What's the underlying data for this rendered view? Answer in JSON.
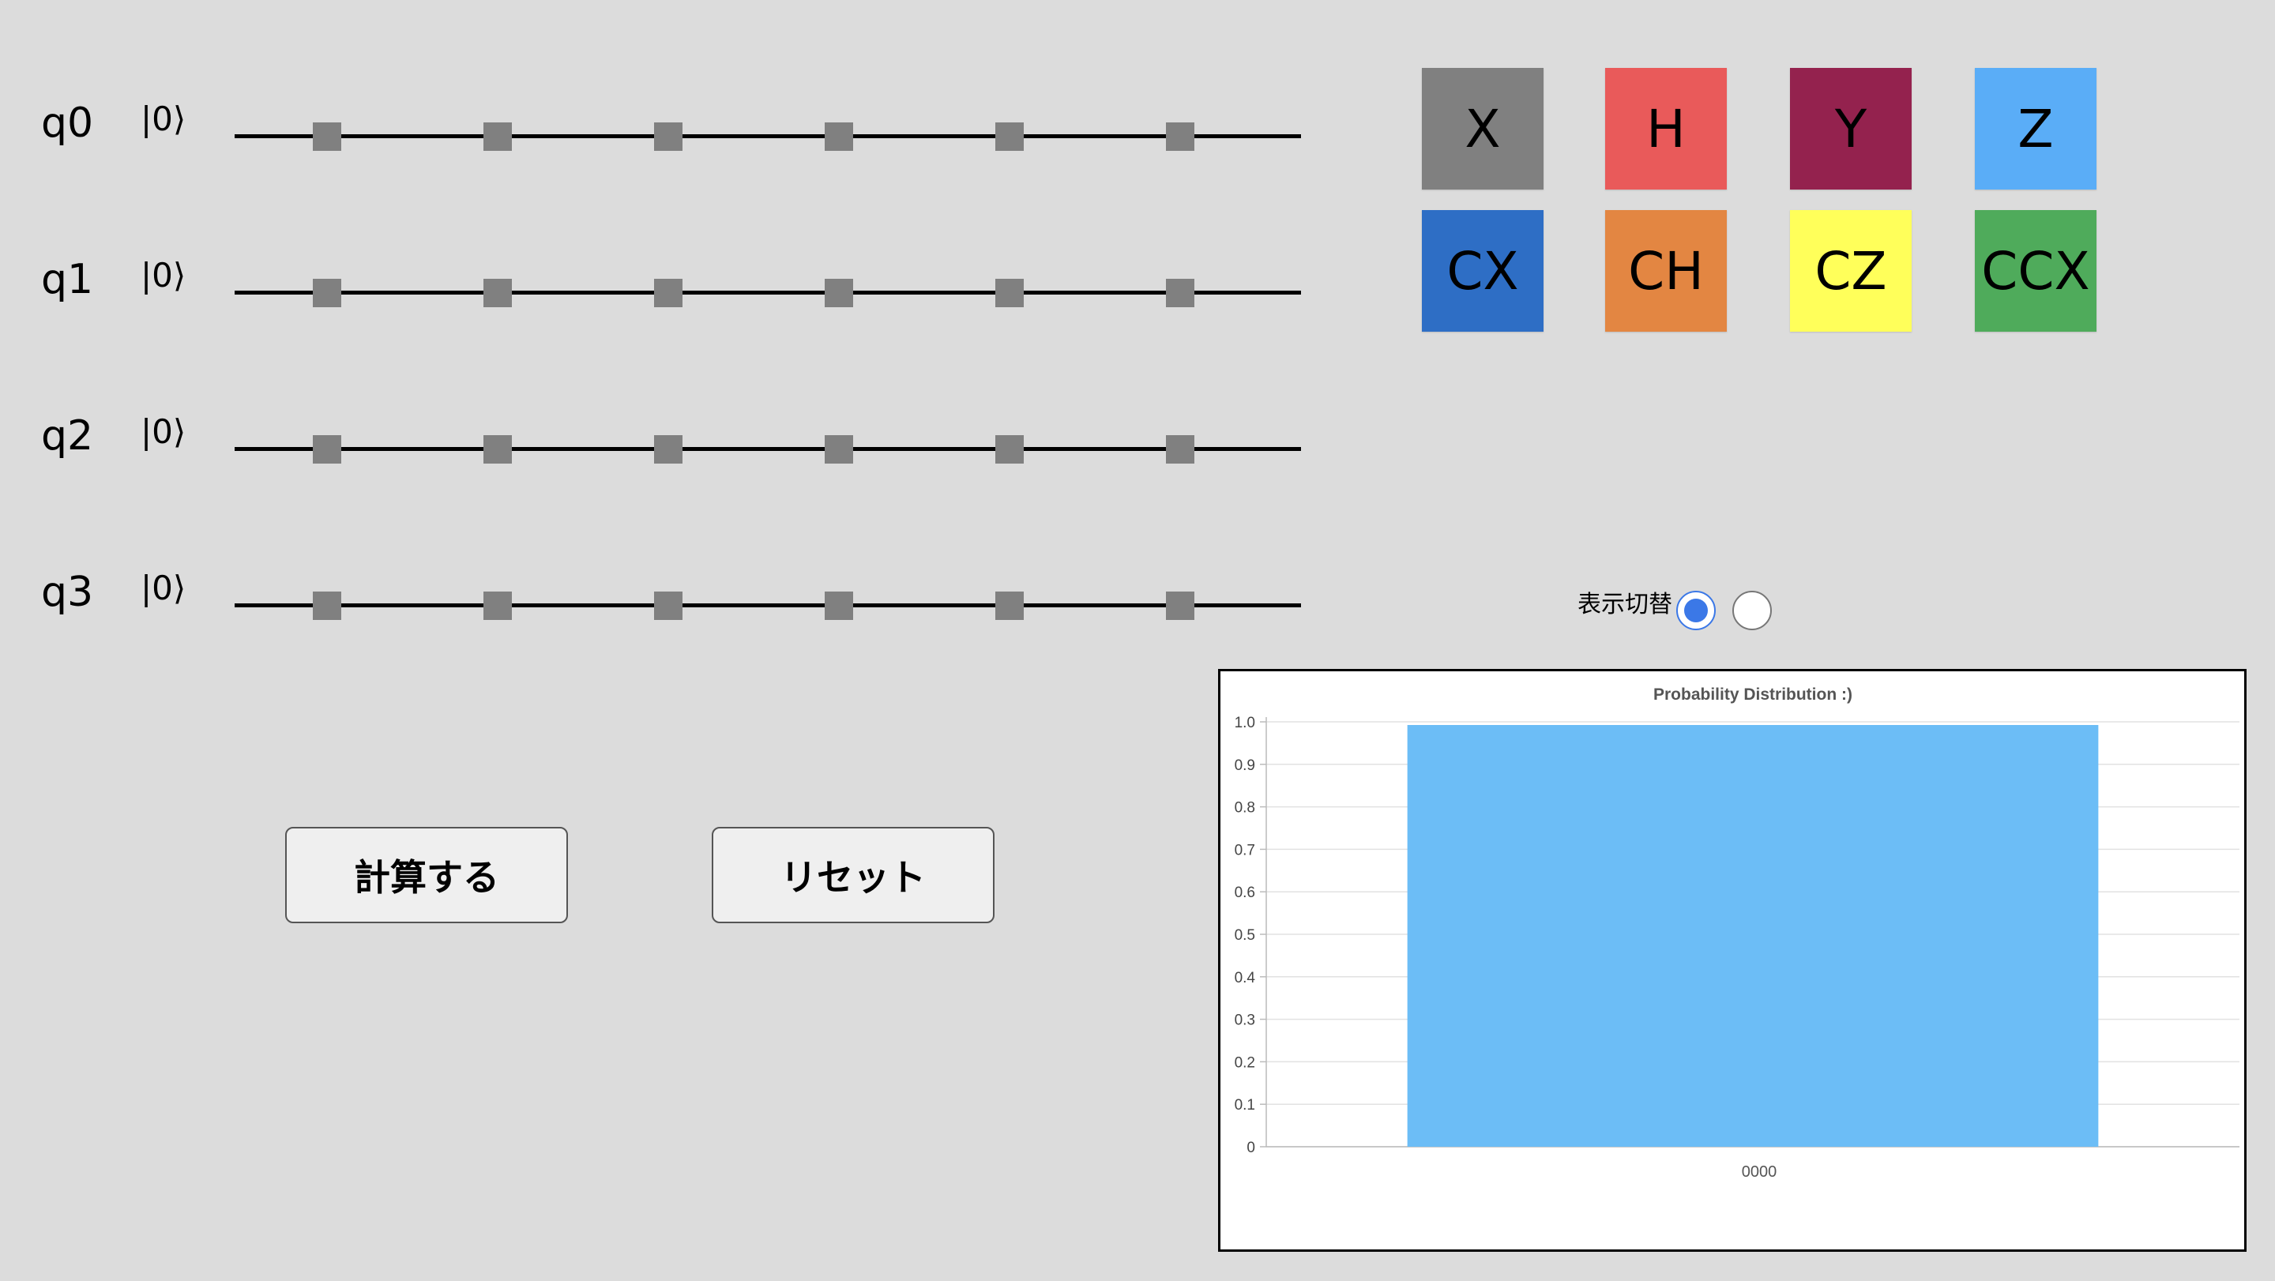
{
  "circuit": {
    "qubits": [
      {
        "label": "q0",
        "ket": "|0⟩"
      },
      {
        "label": "q1",
        "ket": "|0⟩"
      },
      {
        "label": "q2",
        "ket": "|0⟩"
      },
      {
        "label": "q3",
        "ket": "|0⟩"
      }
    ],
    "slots_per_wire": 6,
    "slot_color": "#808080"
  },
  "palette": {
    "gates": [
      {
        "label": "X",
        "color": "#808080"
      },
      {
        "label": "H",
        "color": "#e95a5a"
      },
      {
        "label": "Y",
        "color": "#94224e"
      },
      {
        "label": "Z",
        "color": "#5aadf7"
      },
      {
        "label": "CX",
        "color": "#2e6ec5"
      },
      {
        "label": "CH",
        "color": "#e38642"
      },
      {
        "label": "CZ",
        "color": "#ffff5a"
      },
      {
        "label": "CCX",
        "color": "#4fab5b"
      }
    ]
  },
  "display_toggle": {
    "label": "表示切替",
    "options": [
      {
        "selected": true
      },
      {
        "selected": false
      }
    ]
  },
  "buttons": {
    "calculate": "計算する",
    "reset": "リセット"
  },
  "chart_data": {
    "type": "bar",
    "title": "Probability Distribution :)",
    "categories": [
      "0000"
    ],
    "values": [
      1.0
    ],
    "ylim": [
      0,
      1
    ],
    "yticks": [
      "1.0",
      "0.9",
      "0.8",
      "0.7",
      "0.6",
      "0.5",
      "0.4",
      "0.3",
      "0.2",
      "0.1",
      "0"
    ],
    "grid": true,
    "bar_color": "#6cbdf6"
  }
}
